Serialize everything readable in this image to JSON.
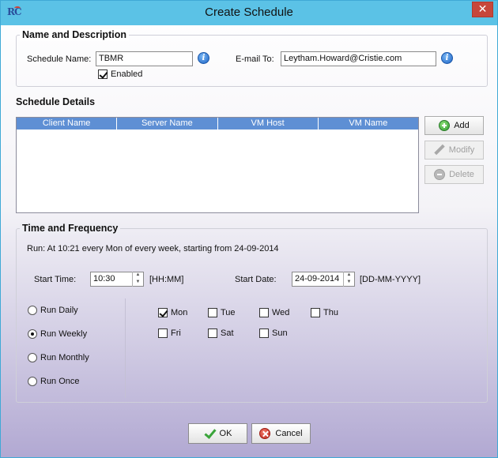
{
  "window": {
    "title": "Create Schedule",
    "app_icon_text": "RC",
    "close_symbol": "✕"
  },
  "name_description": {
    "group_title": "Name and Description",
    "schedule_name_label": "Schedule Name:",
    "schedule_name_value": "TBMR",
    "email_label": "E-mail To:",
    "email_value": "Leytham.Howard@Cristie.com",
    "enabled_label": "Enabled",
    "enabled_checked": true,
    "info_symbol": "i"
  },
  "schedule_details": {
    "group_title": "Schedule Details",
    "columns": [
      "Client Name",
      "Server Name",
      "VM Host",
      "VM Name"
    ],
    "rows": [],
    "add_label": "Add",
    "modify_label": "Modify",
    "delete_label": "Delete"
  },
  "time_frequency": {
    "group_title": "Time and Frequency",
    "summary": "Run:  At 10:21 every Mon of every week, starting from 24-09-2014",
    "start_time_label": "Start Time:",
    "start_time_value": "10:30",
    "start_time_format": "[HH:MM]",
    "start_date_label": "Start Date:",
    "start_date_value": "24-09-2014",
    "start_date_format": "[DD-MM-YYYY]",
    "frequency_options": [
      {
        "label": "Run Daily",
        "checked": false
      },
      {
        "label": "Run Weekly",
        "checked": true
      },
      {
        "label": "Run Monthly",
        "checked": false
      },
      {
        "label": "Run Once",
        "checked": false
      }
    ],
    "days": [
      {
        "label": "Mon",
        "checked": true
      },
      {
        "label": "Tue",
        "checked": false
      },
      {
        "label": "Wed",
        "checked": false
      },
      {
        "label": "Thu",
        "checked": false
      },
      {
        "label": "Fri",
        "checked": false
      },
      {
        "label": "Sat",
        "checked": false
      },
      {
        "label": "Sun",
        "checked": false
      }
    ]
  },
  "footer": {
    "ok_label": "OK",
    "cancel_label": "Cancel"
  },
  "colors": {
    "titlebar": "#5bc2e6",
    "close_button": "#c7473b",
    "table_header": "#5e8fd4"
  }
}
